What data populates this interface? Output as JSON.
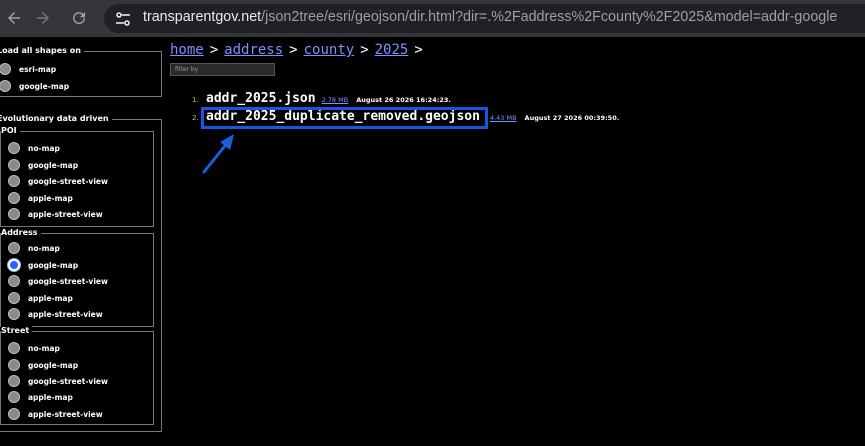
{
  "browser": {
    "url_host": "transparentgov.net",
    "url_path": "/json2tree/esri/geojson/dir.html?dir=.%2Faddress%2Fcounty%2F2025&model=addr-google",
    "icons": [
      "back-arrow-icon",
      "forward-arrow-icon",
      "reload-icon",
      "site-settings-icon"
    ]
  },
  "sidebar": {
    "load_shapes": {
      "legend": "Load all shapes on",
      "options": [
        "esri-map",
        "google-map"
      ]
    },
    "evolutionary": {
      "legend": "Evolutionary data driven",
      "groups": [
        {
          "legend": "POI",
          "options": [
            "no-map",
            "google-map",
            "google-street-view",
            "apple-map",
            "apple-street-view"
          ],
          "selected": null
        },
        {
          "legend": "Address",
          "options": [
            "no-map",
            "google-map",
            "google-street-view",
            "apple-map",
            "apple-street-view"
          ],
          "selected": "google-map"
        },
        {
          "legend": "Street",
          "options": [
            "no-map",
            "google-map",
            "google-street-view",
            "apple-map",
            "apple-street-view"
          ],
          "selected": null
        }
      ]
    }
  },
  "breadcrumb": {
    "items": [
      "home",
      "address",
      "county",
      "2025"
    ],
    "separator": ">"
  },
  "filter": {
    "placeholder": "filter by"
  },
  "files": [
    {
      "num": "1.",
      "name": "addr_2025.json",
      "size": "2.78 MB",
      "date": "August 26 2026 16:24:23."
    },
    {
      "num": "2.",
      "name": "addr_2025_duplicate_removed.geojson",
      "size": "4.43 MB",
      "date": "August 27 2026 00:39:50."
    }
  ],
  "colors": {
    "link": "#7f8fff",
    "highlight": "#1557e0",
    "accent_arrow": "#1a5fe0"
  }
}
